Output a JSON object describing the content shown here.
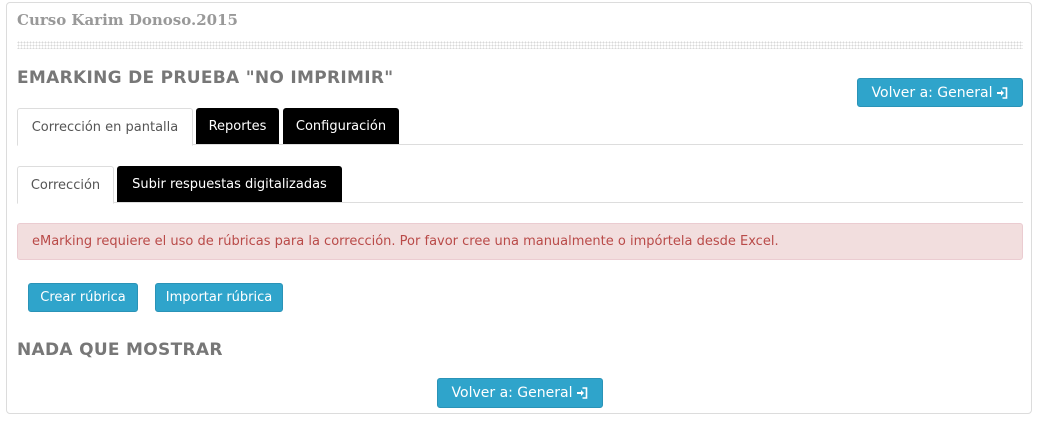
{
  "course": {
    "title": "Curso Karim Donoso.2015"
  },
  "page": {
    "title": "EMARKING DE PRUEBA \"NO IMPRIMIR\""
  },
  "back_button_top": {
    "label": "Volver a: General"
  },
  "main_tabs": [
    {
      "label": "Corrección en pantalla",
      "active": true
    },
    {
      "label": "Reportes",
      "active": false
    },
    {
      "label": "Configuración",
      "active": false
    }
  ],
  "sub_tabs": [
    {
      "label": "Corrección",
      "active": true
    },
    {
      "label": "Subir respuestas digitalizadas",
      "active": false
    }
  ],
  "alert": {
    "message": "eMarking requiere el uso de rúbricas para la corrección. Por favor cree una manualmente o impórtela desde Excel."
  },
  "actions": {
    "create_label": "Crear rúbrica",
    "import_label": "Importar rúbrica"
  },
  "empty_state": {
    "text": "NADA QUE MOSTRAR"
  },
  "back_button_bottom": {
    "label": "Volver a: General"
  },
  "colors": {
    "info_button": "#2fa4cb",
    "alert_bg": "#f2dede",
    "alert_text": "#b94a48",
    "dark_tab": "#000000"
  }
}
